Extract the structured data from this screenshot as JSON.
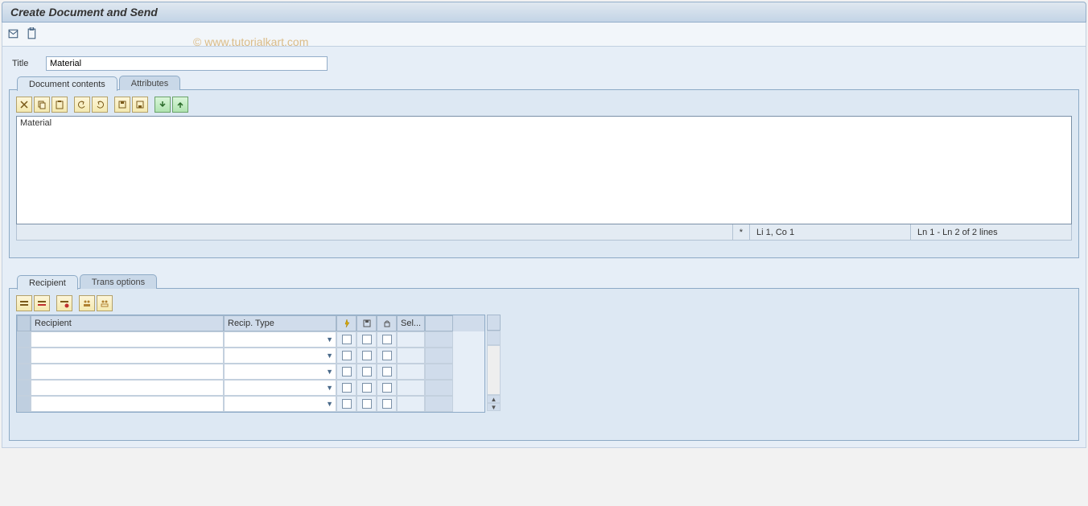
{
  "window": {
    "title": "Create Document and Send"
  },
  "watermark": "© www.tutorialkart.com",
  "fields": {
    "title_label": "Title",
    "title_value": "Material"
  },
  "tabs_upper": [
    {
      "label": "Document contents",
      "active": true
    },
    {
      "label": "Attributes",
      "active": false
    }
  ],
  "editor": {
    "content": "Material",
    "status_modified": "*",
    "status_pos": "Li 1, Co 1",
    "status_range": "Ln 1 - Ln 2 of 2 lines",
    "toolbar": [
      "cut",
      "copy",
      "paste",
      "undo",
      "redo",
      "save",
      "load",
      "import",
      "export"
    ]
  },
  "tabs_lower": [
    {
      "label": "Recipient",
      "active": true
    },
    {
      "label": "Trans options",
      "active": false
    }
  ],
  "recip_toolbar": [
    "insert-row",
    "delete-row",
    "copy-row",
    "distribution-list",
    "address-book"
  ],
  "recip_table": {
    "headers": {
      "recipient": "Recipient",
      "type": "Recip. Type",
      "flag1_icon": "express-icon",
      "flag2_icon": "copy-icon",
      "flag3_icon": "lock-icon",
      "sel": "Sel..."
    },
    "rows": [
      {
        "recipient": "",
        "type": ""
      },
      {
        "recipient": "",
        "type": ""
      },
      {
        "recipient": "",
        "type": ""
      },
      {
        "recipient": "",
        "type": ""
      },
      {
        "recipient": "",
        "type": ""
      }
    ]
  }
}
